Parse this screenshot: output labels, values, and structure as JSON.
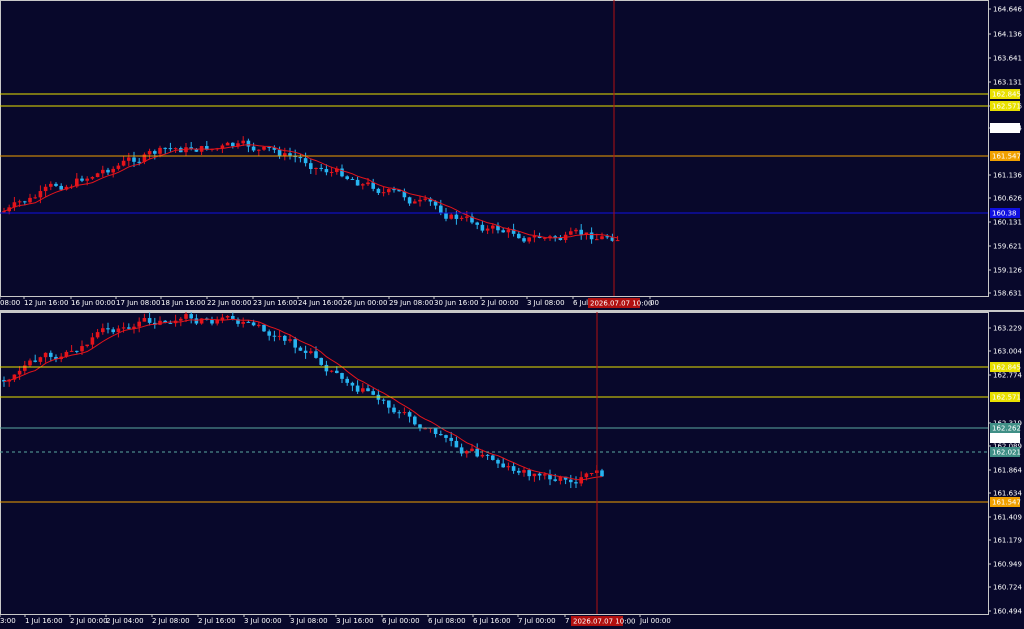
{
  "colors": {
    "background": "#08082b",
    "axis": "#c8c8c8",
    "bull": "#e4141b",
    "bear": "#28b4f0",
    "ma": "#e4141b",
    "yellow_line": "#e8e000",
    "orange_line": "#f0a000",
    "blue_line": "#1010e0",
    "teal_line": "#5aa8a0",
    "vline": "#b01010"
  },
  "top_chart": {
    "price_labels": [
      "164.646",
      "164.136",
      "163.641",
      "163.131",
      "162.636",
      "162.164",
      "161.136",
      "160.626",
      "160.131",
      "159.621",
      "159.126",
      "158.631"
    ],
    "time_labels": [
      "08:00",
      "12 Jun 16:00",
      "16 Jun 00:00",
      "17 Jun 08:00",
      "18 Jun 16:00",
      "22 Jun 00:00",
      "23 Jun 16:00",
      "24 Jun 16:00",
      "26 Jun 00:00",
      "29 Jun 08:00",
      "30 Jun 16:00",
      "2 Jul 00:00",
      "3 Jul 08:00",
      "6 Jul",
      "00"
    ],
    "levels": [
      {
        "label": "162.845",
        "kind": "yellow"
      },
      {
        "label": "162.571",
        "kind": "yellow"
      },
      {
        "label": "161.547",
        "kind": "orange"
      },
      {
        "label": "160.38",
        "kind": "blue"
      }
    ],
    "current_price": "162.164",
    "cursor_time": "2026.07.07 10:00"
  },
  "bottom_chart": {
    "price_labels": [
      "163.229",
      "163.004",
      "162.774",
      "162.319",
      "162.089",
      "161.864",
      "161.634",
      "161.409",
      "161.179",
      "160.949",
      "160.724",
      "160.494"
    ],
    "time_labels": [
      "3:00",
      "1 Jul 16:00",
      "2 Jul 00:00",
      "2 Jul 04:00",
      "2 Jul 08:00",
      "2 Jul 16:00",
      "3 Jul 00:00",
      "3 Jul 08:00",
      "3 Jul 16:00",
      "6 Jul 00:00",
      "6 Jul 08:00",
      "6 Jul 16:00",
      "7 Jul 00:00",
      "7 Jul 08:00",
      "Jul 00:00"
    ],
    "levels": [
      {
        "label": "162.845",
        "kind": "yellow"
      },
      {
        "label": "162.571",
        "kind": "yellow"
      },
      {
        "label": "162.262",
        "kind": "teal"
      },
      {
        "label": "162.021",
        "kind": "teal-dash"
      },
      {
        "label": "161.547",
        "kind": "orange"
      }
    ],
    "current_price": "162.164",
    "cursor_time": "2026.07.07 10:00"
  }
}
